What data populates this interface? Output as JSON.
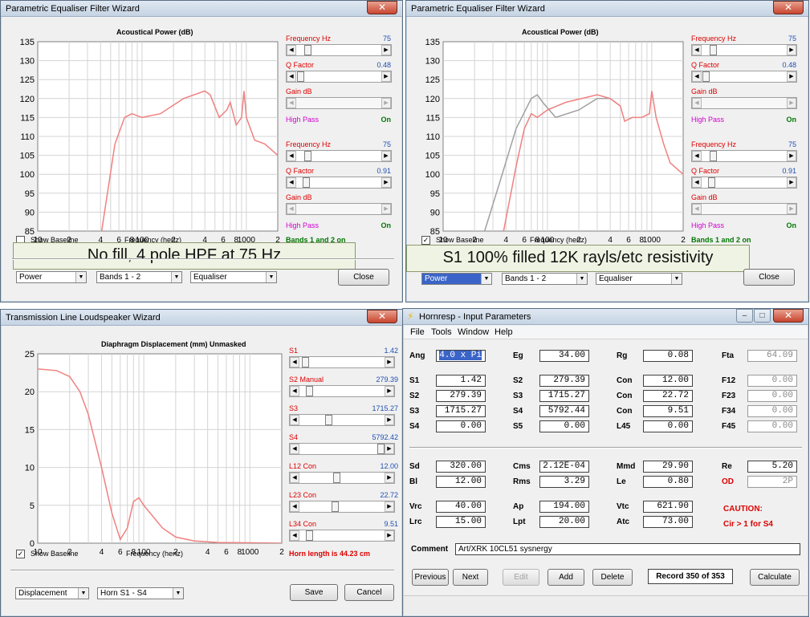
{
  "colors": {
    "title_blue": "#1f4fb0",
    "red": "#dd0000",
    "magenta": "#d000d0",
    "green": "#007700",
    "curve": "#f08080",
    "baseline": "#a0a0a0",
    "label_red": "#c03030"
  },
  "peq1": {
    "title": "Parametric Equaliser Filter Wizard",
    "chart_title": "Acoustical Power (dB)",
    "band1": {
      "freq_label": "Frequency  Hz",
      "freq_value": "75",
      "q_label": "Q Factor",
      "q_value": "0.48",
      "gain_label": "Gain  dB",
      "hp_label": "High Pass",
      "hp_value": "On"
    },
    "band2": {
      "freq_label": "Frequency  Hz",
      "freq_value": "75",
      "q_label": "Q Factor",
      "q_value": "0.91",
      "gain_label": "Gain  dB",
      "hp_label": "High Pass",
      "hp_value": "On"
    },
    "show_baseline": "Show Baseline",
    "baseline_checked": "",
    "freq_label": "Frequency (hertz)",
    "bands_status": "Bands 1 and 2 on",
    "caption": "No fill, 4 pole HPF at 75 Hz",
    "combo1": "Power",
    "combo2": "Bands 1 - 2",
    "combo3": "Equaliser",
    "close": "Close"
  },
  "peq2": {
    "title": "Parametric Equaliser Filter Wizard",
    "chart_title": "Acoustical Power (dB)",
    "band1": {
      "freq_label": "Frequency  Hz",
      "freq_value": "75",
      "q_label": "Q Factor",
      "q_value": "0.48",
      "gain_label": "Gain  dB",
      "hp_label": "High Pass",
      "hp_value": "On"
    },
    "band2": {
      "freq_label": "Frequency  Hz",
      "freq_value": "75",
      "q_label": "Q Factor",
      "q_value": "0.91",
      "gain_label": "Gain  dB",
      "hp_label": "High Pass",
      "hp_value": "On"
    },
    "show_baseline": "Show Baseline",
    "baseline_checked": "✓",
    "freq_label": "Frequency (hertz)",
    "bands_status": "Bands 1 and 2 on",
    "caption": "S1 100% filled 12K rayls/etc resistivity",
    "combo1": "Power",
    "combo2": "Bands 1 - 2",
    "combo3": "Equaliser",
    "close": "Close"
  },
  "tl": {
    "title": "Transmission Line Loudspeaker Wizard",
    "chart_title": "Diaphragm Displacement (mm)   Unmasked",
    "params": [
      {
        "label": "S1",
        "value": "1.42"
      },
      {
        "label": "S2  Manual",
        "value": "279.39"
      },
      {
        "label": "S3",
        "value": "1715.27"
      },
      {
        "label": "S4",
        "value": "5792.42"
      },
      {
        "label": "L12  Con",
        "value": "12.00"
      },
      {
        "label": "L23  Con",
        "value": "22.72"
      },
      {
        "label": "L34  Con",
        "value": "9.51"
      }
    ],
    "show_baseline": "Show Baseline",
    "baseline_checked": "✓",
    "freq_label": "Frequency (hertz)",
    "horn_length": "Horn length is 44.23 cm",
    "combo1": "Displacement",
    "combo2": "Horn S1 - S4",
    "save": "Save",
    "cancel": "Cancel"
  },
  "hr": {
    "title": "Hornresp - Input Parameters",
    "menu": [
      "File",
      "Tools",
      "Window",
      "Help"
    ],
    "rows1": [
      [
        {
          "l": "Ang",
          "v": "4.0 x Pi",
          "sel": true
        },
        {
          "l": "Eg",
          "v": "34.00"
        },
        {
          "l": "Rg",
          "v": "0.08"
        },
        {
          "l": "Fta",
          "v": "64.09",
          "gray": true
        }
      ],
      [
        {
          "l": "S1",
          "v": "1.42"
        },
        {
          "l": "S2",
          "v": "279.39"
        },
        {
          "l": "Con",
          "v": "12.00"
        },
        {
          "l": "F12",
          "v": "0.00",
          "gray": true
        }
      ],
      [
        {
          "l": "S2",
          "v": "279.39"
        },
        {
          "l": "S3",
          "v": "1715.27"
        },
        {
          "l": "Con",
          "v": "22.72"
        },
        {
          "l": "F23",
          "v": "0.00",
          "gray": true
        }
      ],
      [
        {
          "l": "S3",
          "v": "1715.27"
        },
        {
          "l": "S4",
          "v": "5792.44"
        },
        {
          "l": "Con",
          "v": "9.51"
        },
        {
          "l": "F34",
          "v": "0.00",
          "gray": true
        }
      ],
      [
        {
          "l": "S4",
          "v": "0.00"
        },
        {
          "l": "S5",
          "v": "0.00"
        },
        {
          "l": "L45",
          "v": "0.00"
        },
        {
          "l": "F45",
          "v": "0.00",
          "gray": true
        }
      ]
    ],
    "rows2": [
      [
        {
          "l": "Sd",
          "v": "320.00"
        },
        {
          "l": "Cms",
          "v": "2.12E-04"
        },
        {
          "l": "Mmd",
          "v": "29.90"
        },
        {
          "l": "Re",
          "v": "5.20"
        }
      ],
      [
        {
          "l": "Bl",
          "v": "12.00"
        },
        {
          "l": "Rms",
          "v": "3.29"
        },
        {
          "l": "Le",
          "v": "0.80"
        },
        {
          "l": "OD",
          "v": "2P",
          "red": true,
          "gray": true
        }
      ]
    ],
    "rows3": [
      [
        {
          "l": "Vrc",
          "v": "40.00"
        },
        {
          "l": "Ap",
          "v": "194.00"
        },
        {
          "l": "Vtc",
          "v": "621.90"
        }
      ],
      [
        {
          "l": "Lrc",
          "v": "15.00"
        },
        {
          "l": "Lpt",
          "v": "20.00"
        },
        {
          "l": "Atc",
          "v": "73.00"
        }
      ]
    ],
    "caution_title": "CAUTION:",
    "caution_text": "Cir > 1 for S4",
    "comment_label": "Comment",
    "comment": "Art/XRK 10CL51 sysnergy",
    "buttons": {
      "previous": "Previous",
      "next": "Next",
      "edit": "Edit",
      "add": "Add",
      "delete": "Delete",
      "record": "Record 350 of 353",
      "calculate": "Calculate"
    }
  },
  "chart_data": [
    {
      "type": "line",
      "title": "Acoustical Power (dB)",
      "xlabel": "Frequency (hertz)",
      "ylabel": "",
      "x_scale": "log",
      "xlim": [
        10,
        2000
      ],
      "ylim": [
        85,
        135
      ],
      "xticks": [
        "10",
        "2",
        "4",
        "6",
        "8",
        "100",
        "2",
        "4",
        "6",
        "8",
        "1000",
        "2"
      ],
      "yticks": [
        "135",
        "130",
        "125",
        "120",
        "115",
        "110",
        "105",
        "100",
        "95",
        "90",
        "85"
      ],
      "series": [
        {
          "values": [
            [
              41,
              85
            ],
            [
              55,
              108
            ],
            [
              68,
              115
            ],
            [
              80,
              116
            ],
            [
              100,
              115
            ],
            [
              150,
              116
            ],
            [
              250,
              120
            ],
            [
              400,
              122
            ],
            [
              450,
              121
            ],
            [
              550,
              115
            ],
            [
              650,
              117
            ],
            [
              700,
              119
            ],
            [
              800,
              113
            ],
            [
              900,
              115
            ],
            [
              950,
              122
            ],
            [
              1000,
              115
            ],
            [
              1200,
              109
            ],
            [
              1500,
              108
            ],
            [
              2000,
              105
            ]
          ]
        }
      ],
      "grid": true
    },
    {
      "type": "line",
      "title": "Acoustical Power (dB)",
      "xlabel": "Frequency (hertz)",
      "ylabel": "",
      "x_scale": "log",
      "xlim": [
        10,
        2000
      ],
      "ylim": [
        85,
        135
      ],
      "xticks": [
        "10",
        "2",
        "4",
        "6",
        "8",
        "100",
        "2",
        "4",
        "6",
        "8",
        "1000",
        "2"
      ],
      "yticks": [
        "135",
        "130",
        "125",
        "120",
        "115",
        "110",
        "105",
        "100",
        "95",
        "90",
        "85"
      ],
      "series": [
        {
          "values": [
            [
              38,
              85
            ],
            [
              50,
              102
            ],
            [
              60,
              112
            ],
            [
              70,
              116
            ],
            [
              80,
              115
            ],
            [
              100,
              117
            ],
            [
              150,
              119
            ],
            [
              300,
              121
            ],
            [
              400,
              120
            ],
            [
              500,
              118
            ],
            [
              550,
              114
            ],
            [
              650,
              115
            ],
            [
              800,
              115
            ],
            [
              950,
              116
            ],
            [
              1000,
              122
            ],
            [
              1100,
              115
            ],
            [
              1300,
              108
            ],
            [
              1500,
              103
            ],
            [
              2000,
              100
            ]
          ]
        },
        {
          "values": [
            [
              25,
              85
            ],
            [
              35,
              98
            ],
            [
              50,
              112
            ],
            [
              70,
              120
            ],
            [
              80,
              121
            ],
            [
              90,
              119
            ],
            [
              120,
              115
            ],
            [
              200,
              117
            ],
            [
              300,
              120
            ],
            [
              400,
              120
            ],
            [
              500,
              118
            ]
          ]
        }
      ],
      "grid": true
    },
    {
      "type": "line",
      "title": "Diaphragm Displacement (mm)   Unmasked",
      "xlabel": "Frequency (hertz)",
      "ylabel": "",
      "x_scale": "log",
      "xlim": [
        10,
        2000
      ],
      "ylim": [
        0,
        25
      ],
      "xticks": [
        "10",
        "2",
        "4",
        "6",
        "8",
        "100",
        "2",
        "4",
        "6",
        "8",
        "1000",
        "2"
      ],
      "yticks": [
        "25",
        "20",
        "15",
        "10",
        "5",
        "0"
      ],
      "series": [
        {
          "values": [
            [
              10,
              23
            ],
            [
              15,
              22.8
            ],
            [
              20,
              22
            ],
            [
              25,
              20
            ],
            [
              30,
              17
            ],
            [
              40,
              10
            ],
            [
              50,
              4
            ],
            [
              60,
              0.5
            ],
            [
              70,
              2
            ],
            [
              80,
              5.5
            ],
            [
              90,
              6
            ],
            [
              100,
              5
            ],
            [
              150,
              2
            ],
            [
              200,
              0.8
            ],
            [
              300,
              0.3
            ],
            [
              500,
              0.1
            ],
            [
              1000,
              0.05
            ],
            [
              2000,
              0
            ]
          ]
        }
      ],
      "grid": true
    }
  ]
}
